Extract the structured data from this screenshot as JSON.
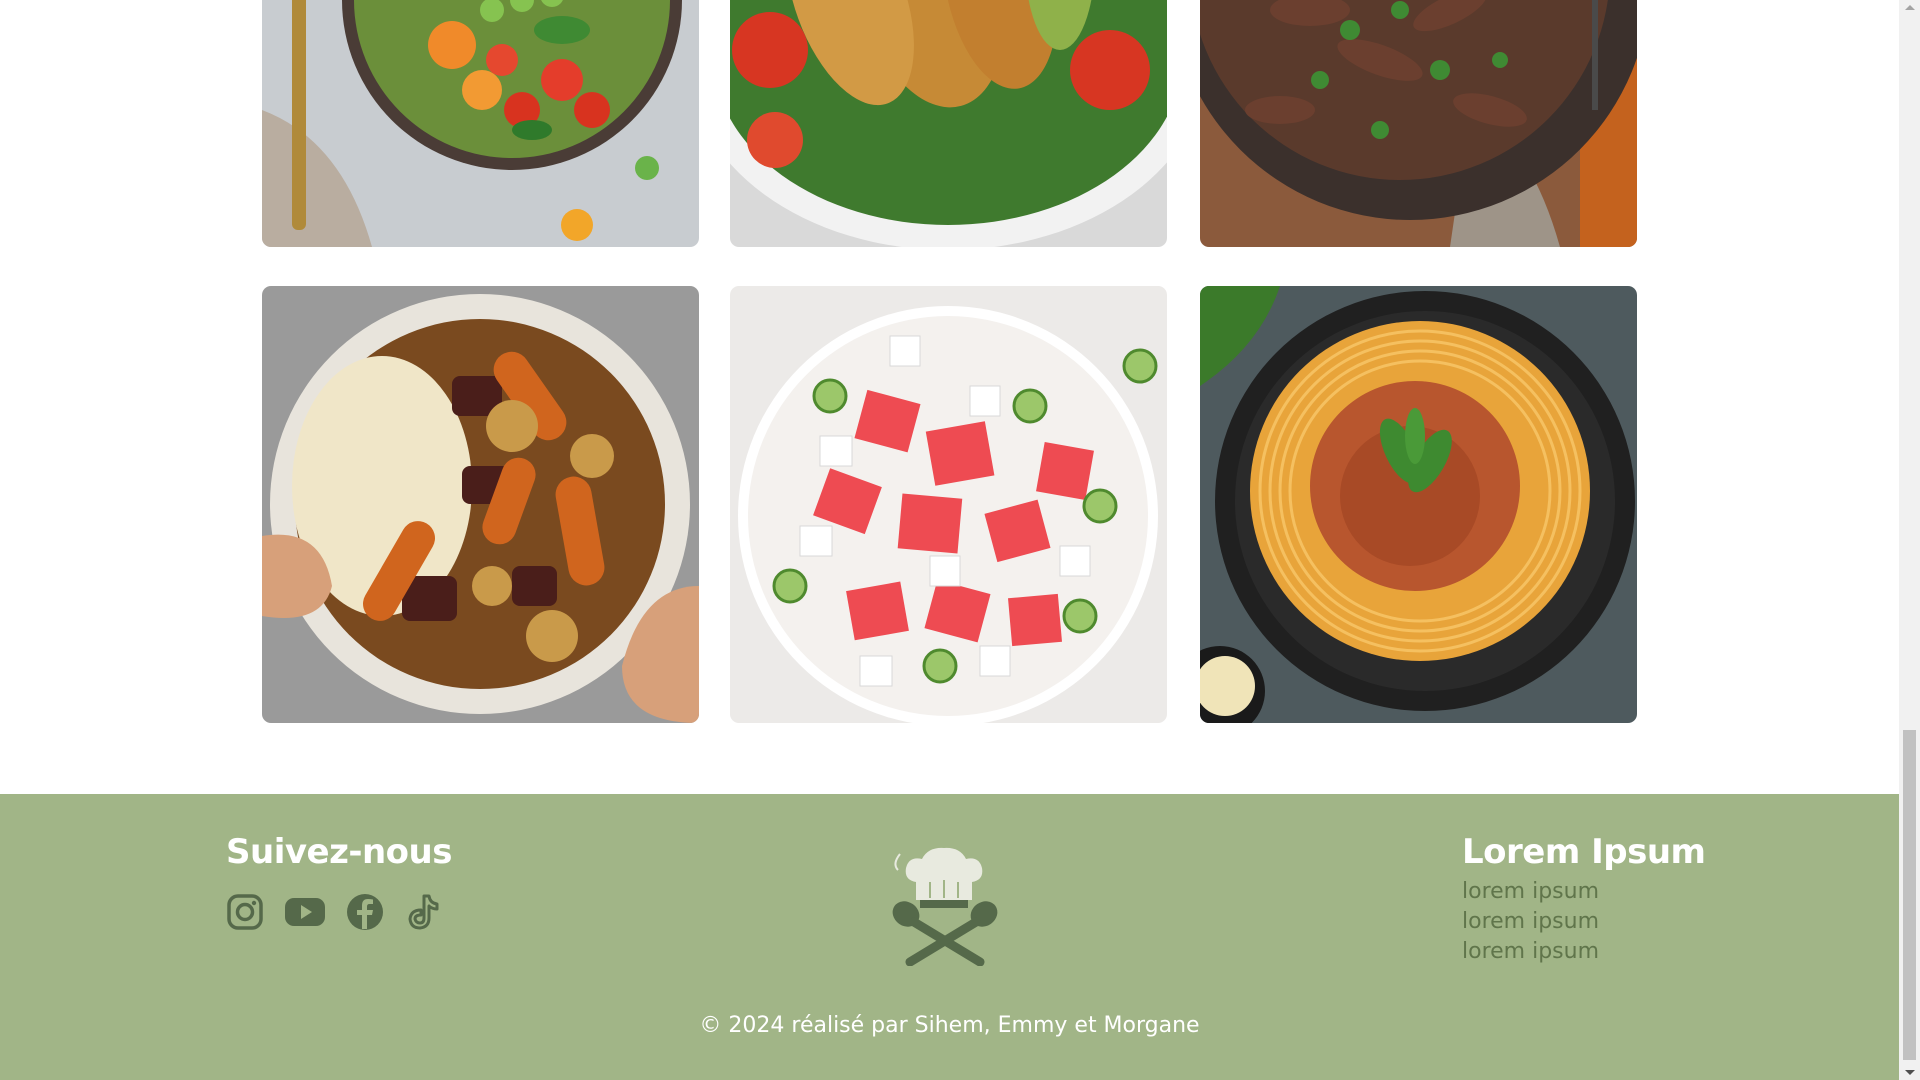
{
  "gallery": [
    {
      "name": "bowl-salad-photo",
      "alt": "Bowl salad"
    },
    {
      "name": "chicken-salad-photo",
      "alt": "Chicken salad"
    },
    {
      "name": "beef-stirfry-photo",
      "alt": "Beef stir-fry"
    },
    {
      "name": "beef-stew-photo",
      "alt": "Beef stew"
    },
    {
      "name": "watermelon-feta-salad-photo",
      "alt": "Watermelon feta salad"
    },
    {
      "name": "spaghetti-bolognese-photo",
      "alt": "Spaghetti bolognese"
    }
  ],
  "footer": {
    "follow_title": "Suivez-nous",
    "social_icons": [
      "instagram-icon",
      "youtube-icon",
      "facebook-icon",
      "tiktok-icon"
    ],
    "links_title": "Lorem Ipsum",
    "links": [
      "lorem ipsum",
      "lorem ipsum",
      "lorem ipsum"
    ],
    "logo_icon": "chef-hat-spoons-icon",
    "copyright": "© 2024 réalisé par Sihem, Emmy et Morgane"
  },
  "colors": {
    "footer_bg": "#a1b587",
    "footer_text": "#ffffff",
    "link_text": "#60754b",
    "icon_color": "#55694a"
  }
}
